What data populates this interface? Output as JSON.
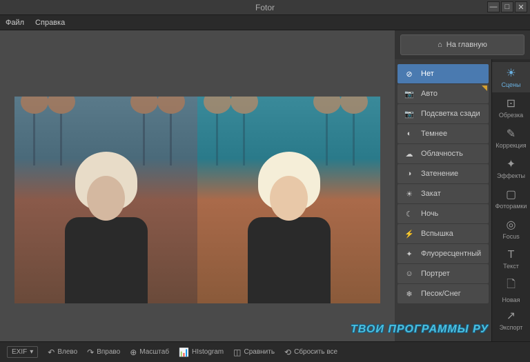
{
  "app": {
    "title": "Fotor"
  },
  "menu": {
    "file": "Файл",
    "help": "Справка"
  },
  "window": {
    "min": "—",
    "max": "□",
    "close": "✕"
  },
  "home_button": "На главную",
  "scenes": [
    {
      "icon": "⊘",
      "label": "Нет",
      "active": true
    },
    {
      "icon": "📷",
      "label": "Авто",
      "badge": true
    },
    {
      "icon": "📷",
      "label": "Подсветка сзади"
    },
    {
      "icon": "◐",
      "label": "Темнее"
    },
    {
      "icon": "☁",
      "label": "Облачность"
    },
    {
      "icon": "◑",
      "label": "Затенение"
    },
    {
      "icon": "☀",
      "label": "Закат"
    },
    {
      "icon": "☾",
      "label": "Ночь"
    },
    {
      "icon": "⚡",
      "label": "Вспышка"
    },
    {
      "icon": "✦",
      "label": "Флуоресцентный"
    },
    {
      "icon": "☺",
      "label": "Портрет"
    },
    {
      "icon": "❄",
      "label": "Песок/Снег"
    }
  ],
  "tools": [
    {
      "icon": "☀",
      "label": "Сцены",
      "active": true
    },
    {
      "icon": "⊡",
      "label": "Обрезка"
    },
    {
      "icon": "✎",
      "label": "Коррекция"
    },
    {
      "icon": "✦",
      "label": "Эффекты"
    },
    {
      "icon": "▢",
      "label": "Фоторамки"
    },
    {
      "icon": "◎",
      "label": "Focus"
    },
    {
      "icon": "T",
      "label": "Текст"
    },
    {
      "icon": "🗋",
      "label": "Новая"
    },
    {
      "icon": "↗",
      "label": "Экспорт"
    }
  ],
  "bottom": {
    "exif": "EXIF",
    "left": "Влево",
    "right": "Вправо",
    "zoom": "Масштаб",
    "histogram": "HIstogram",
    "compare": "Сравнить",
    "reset": "Сбросить все"
  },
  "watermark": "ТВОИ ПРОГРАММЫ РУ"
}
